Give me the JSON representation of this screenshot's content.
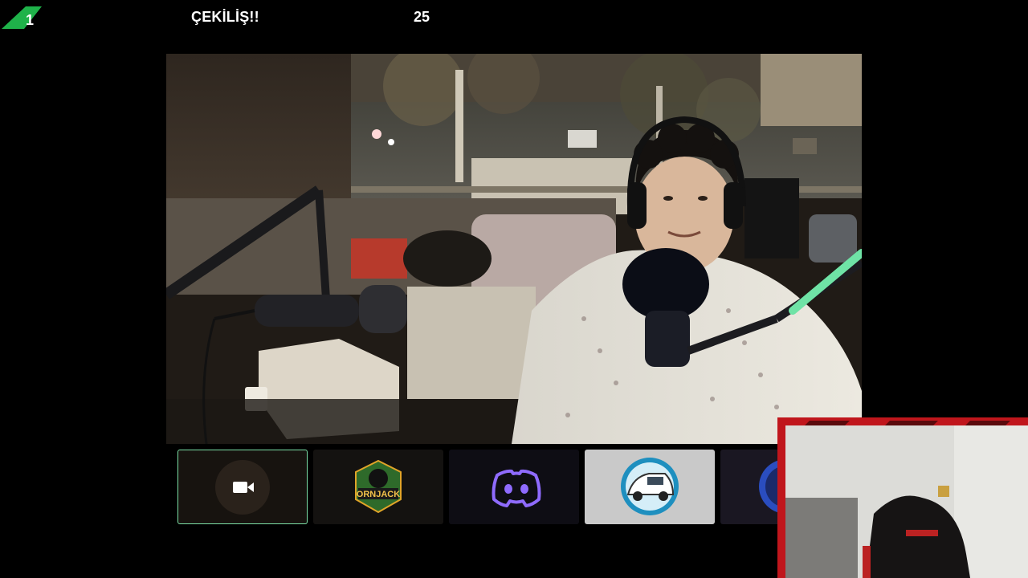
{
  "header": {
    "badge_number": "1",
    "title": "ÇEKİLİŞ!!",
    "counter": "25"
  },
  "colors": {
    "badge_green": "#1fb24a",
    "selected_border": "#7be0a6",
    "discord_purple": "#8f6bff",
    "webcam_frame_red": "#c0161c"
  },
  "participants": [
    {
      "icon": "video-camera-icon",
      "selected": true
    },
    {
      "icon": "ornjack-logo",
      "logo_text": "ORNJACK",
      "selected": false
    },
    {
      "icon": "discord-icon",
      "selected": false
    },
    {
      "icon": "car-avatar-icon",
      "selected": false
    },
    {
      "icon": "partial-avatar-icon",
      "selected": false
    }
  ]
}
